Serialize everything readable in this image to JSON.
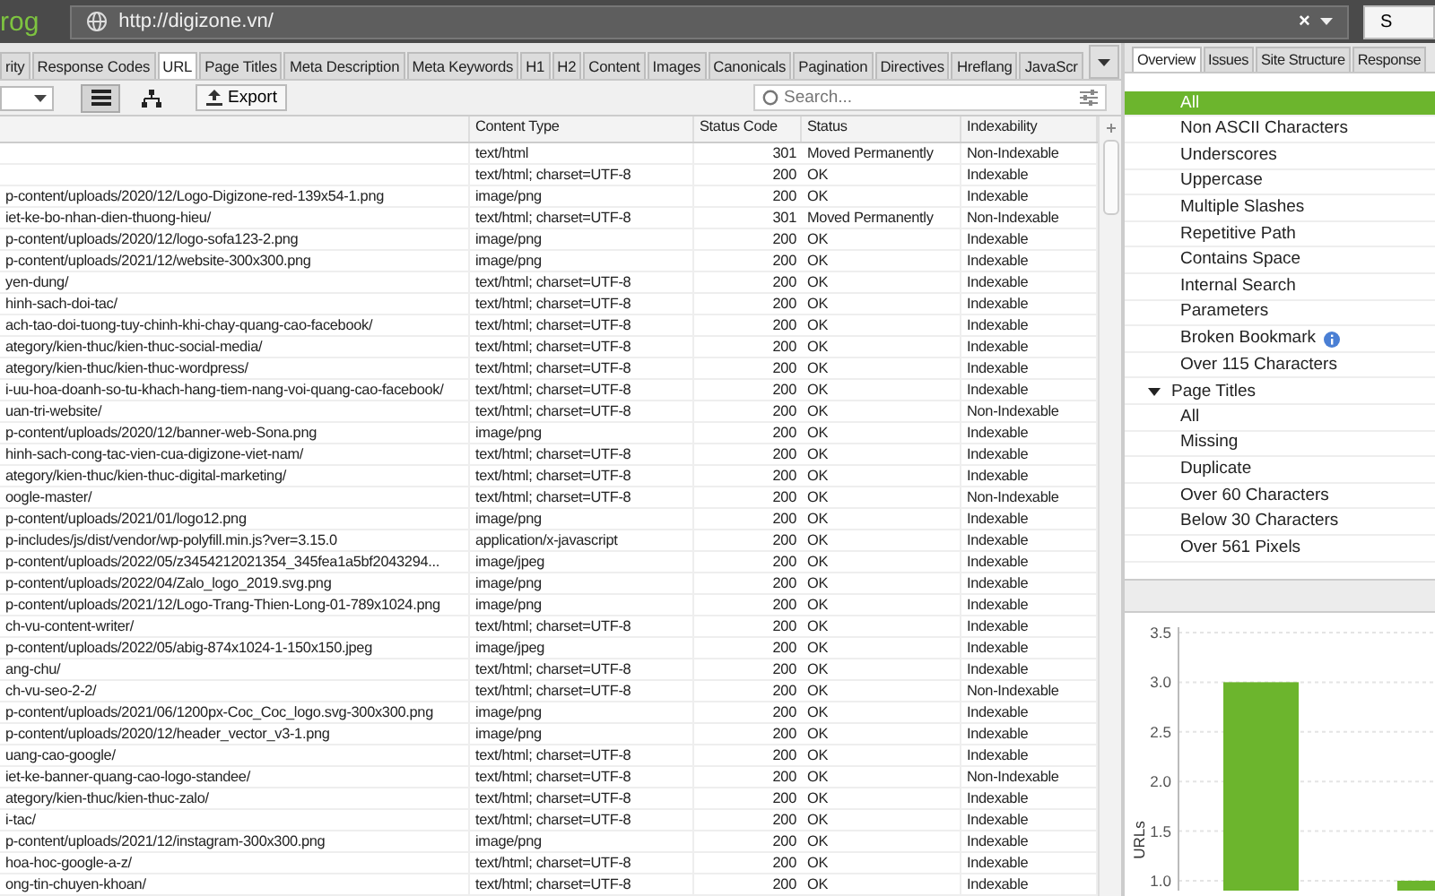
{
  "top_bar": {
    "logo": "rog",
    "url": "http://digizone.vn/",
    "clear": "×",
    "button": "S"
  },
  "tabs": [
    {
      "label": "rity",
      "selected": false
    },
    {
      "label": "Response Codes",
      "selected": false
    },
    {
      "label": "URL",
      "selected": true
    },
    {
      "label": "Page Titles",
      "selected": false
    },
    {
      "label": "Meta Description",
      "selected": false
    },
    {
      "label": "Meta Keywords",
      "selected": false
    },
    {
      "label": "H1",
      "selected": false
    },
    {
      "label": "H2",
      "selected": false
    },
    {
      "label": "Content",
      "selected": false
    },
    {
      "label": "Images",
      "selected": false
    },
    {
      "label": "Canonicals",
      "selected": false
    },
    {
      "label": "Pagination",
      "selected": false
    },
    {
      "label": "Directives",
      "selected": false
    },
    {
      "label": "Hreflang",
      "selected": false
    },
    {
      "label": "JavaScr",
      "selected": false
    }
  ],
  "toolbar": {
    "views": [
      {
        "kind": "list",
        "selected": true
      },
      {
        "kind": "tree",
        "selected": false
      }
    ],
    "export": "Export",
    "search": {
      "placeholder": "Search..."
    }
  },
  "table": {
    "columns": [
      "Content Type",
      "Status Code",
      "Status",
      "Indexability"
    ],
    "rows": [
      {
        "content_type": "text/html",
        "status_code": "301",
        "status": "Moved Permanently",
        "indexability": "Non-Indexable"
      },
      {
        "content_type": "text/html; charset=UTF-8",
        "status_code": "200",
        "status": "OK",
        "indexability": "Indexable"
      },
      {
        "address": "p-content/uploads/2020/12/Logo-Digizone-red-139x54-1.png",
        "content_type": "image/png",
        "status_code": "200",
        "status": "OK",
        "indexability": "Indexable"
      },
      {
        "address": "iet-ke-bo-nhan-dien-thuong-hieu/",
        "content_type": "text/html; charset=UTF-8",
        "status_code": "301",
        "status": "Moved Permanently",
        "indexability": "Non-Indexable"
      },
      {
        "address": "p-content/uploads/2020/12/logo-sofa123-2.png",
        "content_type": "image/png",
        "status_code": "200",
        "status": "OK",
        "indexability": "Indexable"
      },
      {
        "address": "p-content/uploads/2021/12/website-300x300.png",
        "content_type": "image/png",
        "status_code": "200",
        "status": "OK",
        "indexability": "Indexable"
      },
      {
        "address": "yen-dung/",
        "content_type": "text/html; charset=UTF-8",
        "status_code": "200",
        "status": "OK",
        "indexability": "Indexable"
      },
      {
        "address": "hinh-sach-doi-tac/",
        "content_type": "text/html; charset=UTF-8",
        "status_code": "200",
        "status": "OK",
        "indexability": "Indexable"
      },
      {
        "address": "ach-tao-doi-tuong-tuy-chinh-khi-chay-quang-cao-facebook/",
        "content_type": "text/html; charset=UTF-8",
        "status_code": "200",
        "status": "OK",
        "indexability": "Indexable"
      },
      {
        "address": "ategory/kien-thuc/kien-thuc-social-media/",
        "content_type": "text/html; charset=UTF-8",
        "status_code": "200",
        "status": "OK",
        "indexability": "Indexable"
      },
      {
        "address": "ategory/kien-thuc/kien-thuc-wordpress/",
        "content_type": "text/html; charset=UTF-8",
        "status_code": "200",
        "status": "OK",
        "indexability": "Indexable"
      },
      {
        "address": "i-uu-hoa-doanh-so-tu-khach-hang-tiem-nang-voi-quang-cao-facebook/",
        "content_type": "text/html; charset=UTF-8",
        "status_code": "200",
        "status": "OK",
        "indexability": "Indexable"
      },
      {
        "address": "uan-tri-website/",
        "content_type": "text/html; charset=UTF-8",
        "status_code": "200",
        "status": "OK",
        "indexability": "Non-Indexable"
      },
      {
        "address": "p-content/uploads/2020/12/banner-web-Sona.png",
        "content_type": "image/png",
        "status_code": "200",
        "status": "OK",
        "indexability": "Indexable"
      },
      {
        "address": "hinh-sach-cong-tac-vien-cua-digizone-viet-nam/",
        "content_type": "text/html; charset=UTF-8",
        "status_code": "200",
        "status": "OK",
        "indexability": "Indexable"
      },
      {
        "address": "ategory/kien-thuc/kien-thuc-digital-marketing/",
        "content_type": "text/html; charset=UTF-8",
        "status_code": "200",
        "status": "OK",
        "indexability": "Indexable"
      },
      {
        "address": "oogle-master/",
        "content_type": "text/html; charset=UTF-8",
        "status_code": "200",
        "status": "OK",
        "indexability": "Non-Indexable"
      },
      {
        "address": "p-content/uploads/2021/01/logo12.png",
        "content_type": "image/png",
        "status_code": "200",
        "status": "OK",
        "indexability": "Indexable"
      },
      {
        "address": "p-includes/js/dist/vendor/wp-polyfill.min.js?ver=3.15.0",
        "content_type": "application/x-javascript",
        "status_code": "200",
        "status": "OK",
        "indexability": "Indexable"
      },
      {
        "address": "p-content/uploads/2022/05/z3454212021354_345fea1a5bf2043294...",
        "content_type": "image/jpeg",
        "status_code": "200",
        "status": "OK",
        "indexability": "Indexable"
      },
      {
        "address": "p-content/uploads/2022/04/Zalo_logo_2019.svg.png",
        "content_type": "image/png",
        "status_code": "200",
        "status": "OK",
        "indexability": "Indexable"
      },
      {
        "address": "p-content/uploads/2021/12/Logo-Trang-Thien-Long-01-789x1024.png",
        "content_type": "image/png",
        "status_code": "200",
        "status": "OK",
        "indexability": "Indexable"
      },
      {
        "address": "ch-vu-content-writer/",
        "content_type": "text/html; charset=UTF-8",
        "status_code": "200",
        "status": "OK",
        "indexability": "Indexable"
      },
      {
        "address": "p-content/uploads/2022/05/abig-874x1024-1-150x150.jpeg",
        "content_type": "image/jpeg",
        "status_code": "200",
        "status": "OK",
        "indexability": "Indexable"
      },
      {
        "address": "ang-chu/",
        "content_type": "text/html; charset=UTF-8",
        "status_code": "200",
        "status": "OK",
        "indexability": "Indexable"
      },
      {
        "address": "ch-vu-seo-2-2/",
        "content_type": "text/html; charset=UTF-8",
        "status_code": "200",
        "status": "OK",
        "indexability": "Non-Indexable"
      },
      {
        "address": "p-content/uploads/2021/06/1200px-Coc_Coc_logo.svg-300x300.png",
        "content_type": "image/png",
        "status_code": "200",
        "status": "OK",
        "indexability": "Indexable"
      },
      {
        "address": "p-content/uploads/2020/12/header_vector_v3-1.png",
        "content_type": "image/png",
        "status_code": "200",
        "status": "OK",
        "indexability": "Indexable"
      },
      {
        "address": "uang-cao-google/",
        "content_type": "text/html; charset=UTF-8",
        "status_code": "200",
        "status": "OK",
        "indexability": "Indexable"
      },
      {
        "address": "iet-ke-banner-quang-cao-logo-standee/",
        "content_type": "text/html; charset=UTF-8",
        "status_code": "200",
        "status": "OK",
        "indexability": "Non-Indexable"
      },
      {
        "address": "ategory/kien-thuc/kien-thuc-zalo/",
        "content_type": "text/html; charset=UTF-8",
        "status_code": "200",
        "status": "OK",
        "indexability": "Indexable"
      },
      {
        "address": "i-tac/",
        "content_type": "text/html; charset=UTF-8",
        "status_code": "200",
        "status": "OK",
        "indexability": "Indexable"
      },
      {
        "address": "p-content/uploads/2021/12/instagram-300x300.png",
        "content_type": "image/png",
        "status_code": "200",
        "status": "OK",
        "indexability": "Indexable"
      },
      {
        "address": "hoa-hoc-google-a-z/",
        "content_type": "text/html; charset=UTF-8",
        "status_code": "200",
        "status": "OK",
        "indexability": "Indexable"
      },
      {
        "address": "ong-tin-chuyen-khoan/",
        "content_type": "text/html; charset=UTF-8",
        "status_code": "200",
        "status": "OK",
        "indexability": "Indexable"
      }
    ]
  },
  "side_tabs": [
    {
      "label": "Overview",
      "selected": true
    },
    {
      "label": "Issues",
      "selected": false
    },
    {
      "label": "Site Structure",
      "selected": false
    },
    {
      "label": "Response",
      "selected": false
    }
  ],
  "overview": {
    "url_filters": [
      {
        "label": "All",
        "selected": true,
        "info": false
      },
      {
        "label": "Non ASCII Characters",
        "selected": false,
        "info": false
      },
      {
        "label": "Underscores",
        "selected": false,
        "info": false
      },
      {
        "label": "Uppercase",
        "selected": false,
        "info": false
      },
      {
        "label": "Multiple Slashes",
        "selected": false,
        "info": false
      },
      {
        "label": "Repetitive Path",
        "selected": false,
        "info": false
      },
      {
        "label": "Contains Space",
        "selected": false,
        "info": false
      },
      {
        "label": "Internal Search",
        "selected": false,
        "info": false
      },
      {
        "label": "Parameters",
        "selected": false,
        "info": false
      },
      {
        "label": "Broken Bookmark",
        "selected": false,
        "info": true
      },
      {
        "label": "Over 115 Characters",
        "selected": false,
        "info": false
      }
    ],
    "groups": [
      {
        "label": "Page Titles",
        "expanded": true,
        "children": [
          {
            "label": "All",
            "selected": false
          },
          {
            "label": "Missing",
            "selected": false
          },
          {
            "label": "Duplicate",
            "selected": false
          },
          {
            "label": "Over 60 Characters",
            "selected": false
          },
          {
            "label": "Below 30 Characters",
            "selected": false
          },
          {
            "label": "Over 561 Pixels",
            "selected": false
          }
        ]
      }
    ]
  },
  "chart_data": {
    "type": "bar",
    "grid": true,
    "ylabel": "URLs",
    "values": [
      3.0,
      1.0
    ],
    "ylim": [
      0.9,
      3.5
    ],
    "yticks": [
      {
        "value": 1,
        "label": "1.0"
      },
      {
        "value": 1.5,
        "label": "1.5"
      },
      {
        "value": 2,
        "label": "2.0"
      },
      {
        "value": 2.5,
        "label": "2.5"
      },
      {
        "value": 3,
        "label": "3.0"
      },
      {
        "value": 3.5,
        "label": "3.5"
      }
    ]
  }
}
